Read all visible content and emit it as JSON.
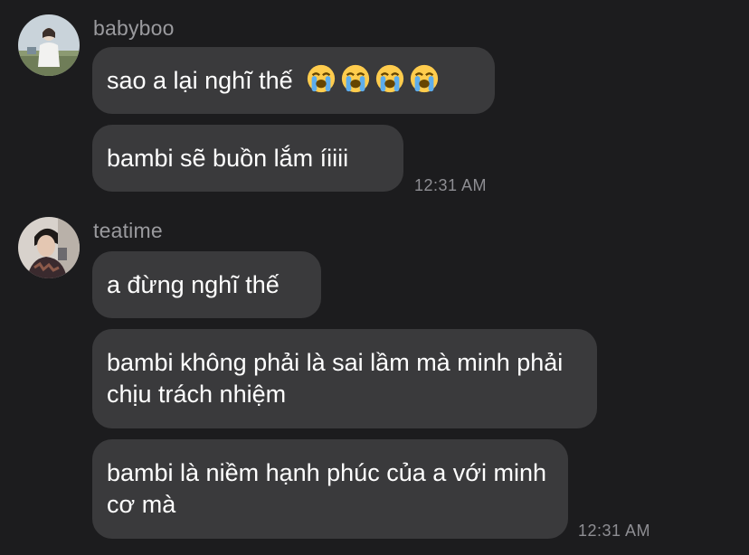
{
  "messages": [
    {
      "sender": "babyboo",
      "bubbles": [
        {
          "text": "sao a lại nghĩ thế",
          "emojis": [
            "loudly-crying-face",
            "loudly-crying-face",
            "loudly-crying-face",
            "loudly-crying-face"
          ]
        },
        {
          "text": "bambi sẽ buồn lắm íiiii"
        }
      ],
      "time": "12:31 AM"
    },
    {
      "sender": "teatime",
      "bubbles": [
        {
          "text": "a đừng nghĩ thế"
        },
        {
          "text": "bambi không phải là sai lầm mà minh phải chịu trách nhiệm"
        },
        {
          "text": "bambi là niềm hạnh phúc của a với minh cơ mà"
        }
      ],
      "time": "12:31 AM"
    }
  ],
  "colors": {
    "background": "#1c1c1e",
    "bubble": "#3a3a3c",
    "text": "#ffffff",
    "secondary": "#9a9a9e"
  }
}
